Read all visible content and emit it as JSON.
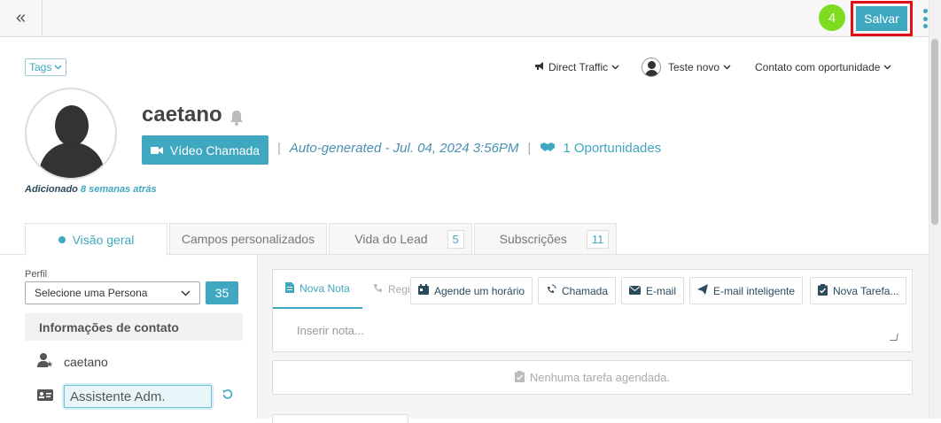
{
  "topbar": {
    "collapse_glyph": "«",
    "badge_count": "4",
    "save_label": "Salvar"
  },
  "header": {
    "tags_label": "Tags",
    "source_label": "Direct Traffic",
    "owner_label": "Teste novo",
    "stage_label": "Contato com oportunidade"
  },
  "contact": {
    "name": "caetano",
    "added_prefix": "Adicionado",
    "added_time": "8 semanas atrás",
    "video_call_label": "Vídeo Chamada",
    "autogen_text": "Auto-generated - Jul. 04, 2024 3:56PM",
    "separator": "|",
    "opportunities_label": "1 Oportunidades"
  },
  "tabs": [
    {
      "label": "Visão geral",
      "count": ""
    },
    {
      "label": "Campos personalizados",
      "count": ""
    },
    {
      "label": "Vida do Lead",
      "count": "5"
    },
    {
      "label": "Subscrições",
      "count": "11"
    }
  ],
  "profile": {
    "label": "Perfil",
    "select_value": "Selecione uma Persona",
    "count": "35"
  },
  "contact_info": {
    "header": "Informações de contato",
    "name_value": "caetano",
    "job_value": "Assistente Adm."
  },
  "notes": {
    "tab_note": "Nova Nota",
    "tab_register": "Regi",
    "actions": [
      "Agende um horário",
      "Chamada",
      "E-mail",
      "E-mail inteligente",
      "Nova Tarefa..."
    ],
    "placeholder": "Inserir nota...",
    "no_task": "Nenhuma tarefa agendada."
  },
  "colors": {
    "accent": "#3fa7bf",
    "badge": "#7ddc1f",
    "highlight_border": "#e0101a"
  }
}
